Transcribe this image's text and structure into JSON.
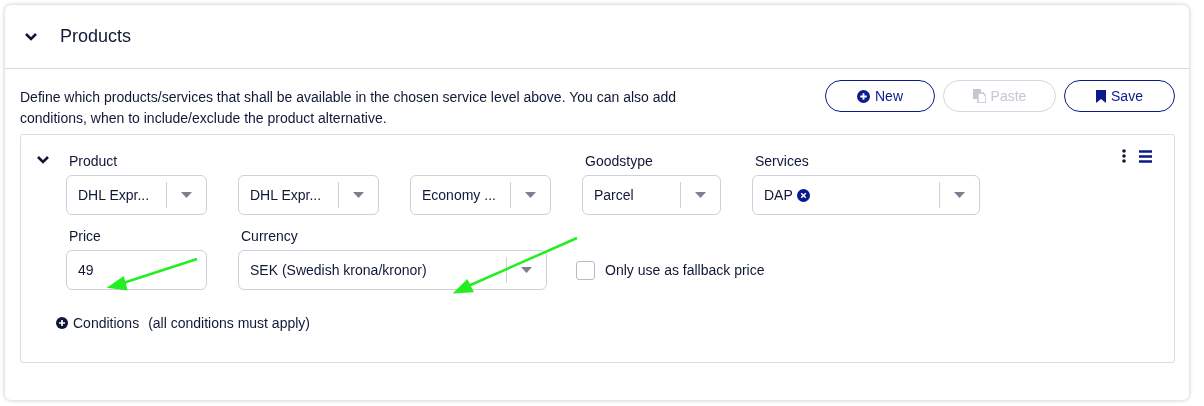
{
  "section": {
    "title": "Products",
    "expanded": true
  },
  "description": "Define which products/services that shall be available in the chosen service level above. You can also add conditions, when to include/exclude the product alternative.",
  "buttons": [
    {
      "label": "New",
      "disabled": false
    },
    {
      "label": "Paste",
      "disabled": true
    },
    {
      "label": "Save",
      "disabled": false
    }
  ],
  "product_row": {
    "expanded": true,
    "service_fields": [
      {
        "kind": "select",
        "label": "Product",
        "value": "DHL Expr..."
      },
      {
        "kind": "select",
        "value": "DHL Expr..."
      },
      {
        "kind": "select",
        "value": "Economy ..."
      },
      {
        "kind": "select",
        "label": "Goodstype",
        "value": "Parcel"
      },
      {
        "kind": "tags",
        "label": "Services",
        "tags": [
          "DAP"
        ]
      }
    ],
    "price_fields": [
      {
        "kind": "input",
        "label": "Price",
        "value": "49"
      },
      {
        "kind": "select",
        "label": "Currency",
        "value": "SEK (Swedish krona/kronor)"
      },
      {
        "kind": "checkbox",
        "label": "Only use as fallback price",
        "checked": false
      }
    ],
    "conditions": {
      "label": "Conditions",
      "hint": "(all conditions must apply)"
    }
  }
}
